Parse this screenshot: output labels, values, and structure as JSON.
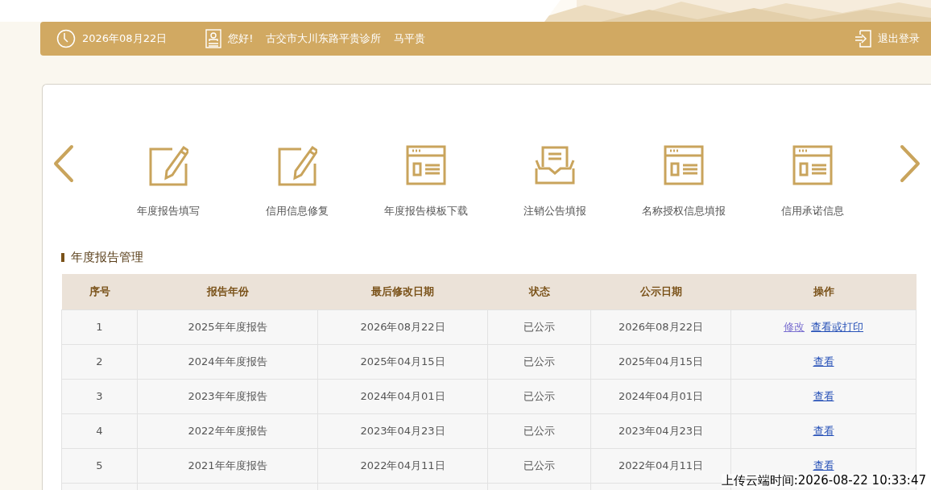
{
  "header": {
    "date": "2026年08月22日",
    "greeting": "您好!",
    "org": "古交市大川东路平贵诊所",
    "user": "马平贵",
    "logout": "退出登录"
  },
  "shortcuts": [
    {
      "kind": "edit",
      "label": "年度报告填写"
    },
    {
      "kind": "edit",
      "label": "信用信息修复"
    },
    {
      "kind": "form",
      "label": "年度报告模板下载"
    },
    {
      "kind": "tray",
      "label": "注销公告填报"
    },
    {
      "kind": "form",
      "label": "名称授权信息填报"
    },
    {
      "kind": "form",
      "label": "信用承诺信息"
    }
  ],
  "section_title": "年度报告管理",
  "table": {
    "columns": [
      "序号",
      "报告年份",
      "最后修改日期",
      "状态",
      "公示日期",
      "操作"
    ],
    "rows": [
      {
        "cells": [
          "1",
          "2025年年度报告",
          "2026年08月22日",
          "已公示",
          "2026年08月22日"
        ],
        "actions": [
          {
            "label": "修改",
            "visited": true
          },
          {
            "label": "查看或打印",
            "visited": false
          }
        ]
      },
      {
        "cells": [
          "2",
          "2024年年度报告",
          "2025年04月15日",
          "已公示",
          "2025年04月15日"
        ],
        "actions": [
          {
            "label": "查看",
            "visited": false
          }
        ]
      },
      {
        "cells": [
          "3",
          "2023年年度报告",
          "2024年04月01日",
          "已公示",
          "2024年04月01日"
        ],
        "actions": [
          {
            "label": "查看",
            "visited": false
          }
        ]
      },
      {
        "cells": [
          "4",
          "2022年年度报告",
          "2023年04月23日",
          "已公示",
          "2023年04月23日"
        ],
        "actions": [
          {
            "label": "查看",
            "visited": false
          }
        ]
      },
      {
        "cells": [
          "5",
          "2021年年度报告",
          "2022年04月11日",
          "已公示",
          "2022年04月11日"
        ],
        "actions": [
          {
            "label": "查看",
            "visited": false
          }
        ]
      }
    ]
  },
  "upload_stamp": "上传云端时间:2026-08-22 10:33:47"
}
